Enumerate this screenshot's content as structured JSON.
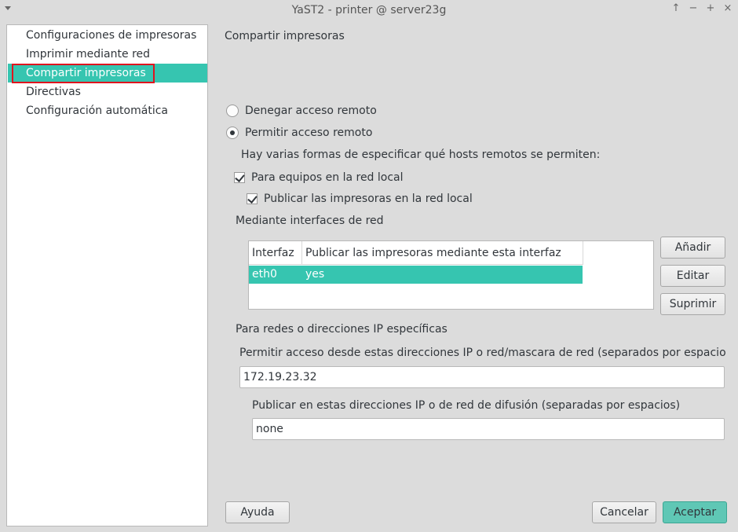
{
  "window": {
    "title": "YaST2 - printer @ server23g",
    "controls": {
      "keep_above": "↑",
      "minimize": "−",
      "maximize": "+",
      "close": "×"
    }
  },
  "sidebar": {
    "items": [
      {
        "label": "Configuraciones de impresoras",
        "selected": false
      },
      {
        "label": "Imprimir mediante red",
        "selected": false
      },
      {
        "label": "Compartir impresoras",
        "selected": true
      },
      {
        "label": "Directivas",
        "selected": false
      },
      {
        "label": "Configuración automática",
        "selected": false
      }
    ]
  },
  "main": {
    "title": "Compartir impresoras",
    "radio_deny": "Denegar acceso remoto",
    "radio_allow": "Permitir acceso remoto",
    "hosts_intro": "Hay varias formas de especificar qué hosts remotos se permiten:",
    "check_local_net": "Para equipos en la red local",
    "check_publish_local": "Publicar las impresoras en la red local",
    "interfaces_label": "Mediante interfaces de red",
    "table": {
      "columns": [
        "Interfaz",
        "Publicar las impresoras mediante esta interfaz"
      ],
      "rows": [
        {
          "interface": "eth0",
          "publish": "yes"
        }
      ]
    },
    "btn_add": "Añadir",
    "btn_edit": "Editar",
    "btn_delete": "Suprimir",
    "ip_section_label": "Para redes o direcciones IP específicas",
    "allow_ip_label": "Permitir acceso desde estas direcciones IP o red/mascara de red (separados por espacio",
    "allow_ip_value": "172.19.23.32",
    "publish_ip_label": "Publicar en estas direcciones IP o de red de difusión (separadas por espacios)",
    "publish_ip_value": "none"
  },
  "footer": {
    "help": "Ayuda",
    "cancel": "Cancelar",
    "accept": "Aceptar"
  },
  "colors": {
    "selection": "#36c5b0",
    "primary_button": "#5fc7b5",
    "highlight_outline": "#e0141e"
  }
}
